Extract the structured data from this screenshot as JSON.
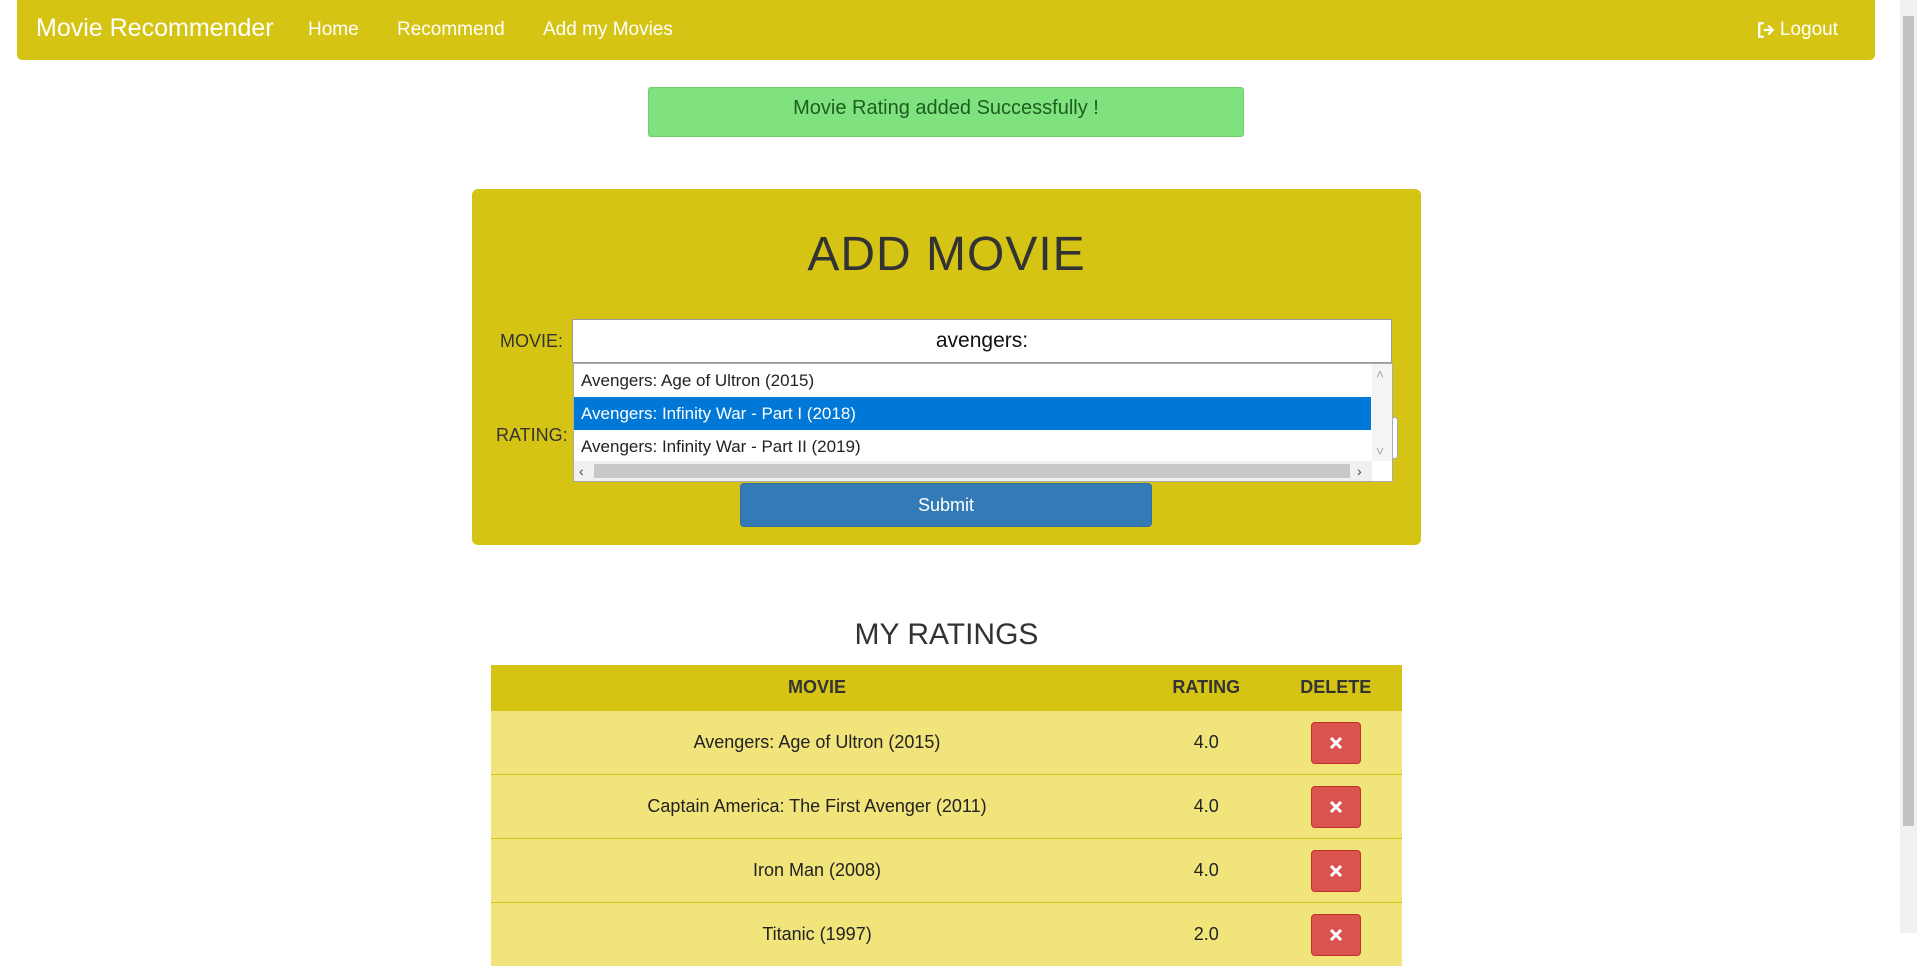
{
  "navbar": {
    "brand": "Movie Recommender",
    "links": [
      "Home",
      "Recommend",
      "Add my Movies"
    ],
    "logout_label": "Logout"
  },
  "alert": {
    "message": "Movie Rating added Successfully !"
  },
  "form": {
    "title": "ADD MOVIE",
    "movie_label": "MOVIE:",
    "movie_value": "avengers:",
    "rating_label": "RATING:",
    "submit_label": "Submit"
  },
  "autocomplete": {
    "options": [
      "Avengers: Age of Ultron (2015)",
      "Avengers: Infinity War - Part I (2018)",
      "Avengers: Infinity War - Part II (2019)"
    ],
    "selected_index": 1
  },
  "ratings": {
    "title": "MY RATINGS",
    "headers": [
      "MOVIE",
      "RATING",
      "DELETE"
    ],
    "rows": [
      {
        "movie": "Avengers: Age of Ultron (2015)",
        "rating": "4.0"
      },
      {
        "movie": "Captain America: The First Avenger (2011)",
        "rating": "4.0"
      },
      {
        "movie": "Iron Man (2008)",
        "rating": "4.0"
      },
      {
        "movie": "Titanic (1997)",
        "rating": "2.0"
      }
    ]
  },
  "colors": {
    "accent": "#d6c414",
    "row_bg": "#f1e47a",
    "alert_bg": "#80e27e",
    "submit_bg": "#337ab7",
    "delete_bg": "#d9534f",
    "selected_option_bg": "#0078d7"
  },
  "icons": {
    "logout": "logout-icon",
    "delete": "close-icon"
  }
}
